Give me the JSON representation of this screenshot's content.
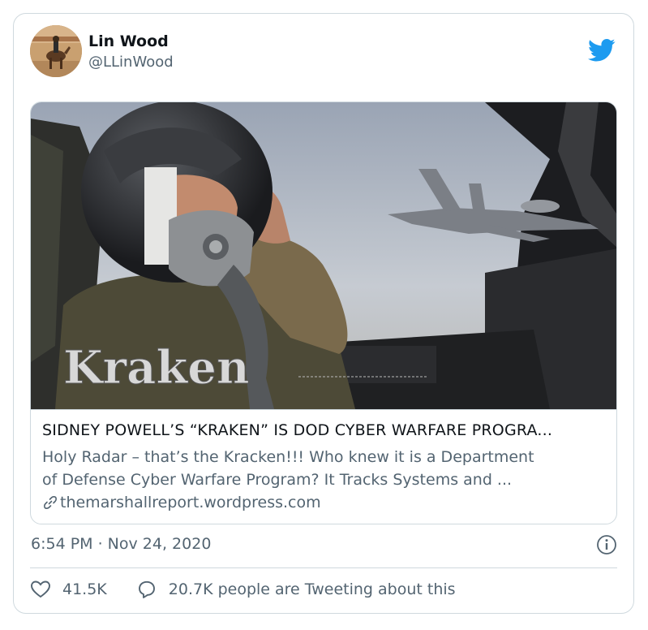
{
  "tweet": {
    "author": {
      "display_name": "Lin Wood",
      "handle": "@LLinWood",
      "avatar_icon": "avatar-horse-rider"
    },
    "brand_icon": "twitter-bird-icon",
    "brand_color": "#1d9bf0",
    "link_card": {
      "image_overlay_text": "Kraken",
      "title": "SIDNEY POWELL’S “KRAKEN” IS DOD CYBER WARFARE PROGRA...",
      "description_line1": "Holy Radar – that’s the Kracken!!! Who knew it is a Department",
      "description_line2": "of Defense Cyber Warfare Program? It Tracks Systems and ...",
      "domain": "themarshallreport.wordpress.com",
      "domain_icon": "link-icon"
    },
    "timestamp": "6:54 PM · Nov 24, 2020",
    "info_icon": "info-icon",
    "likes": "41.5K",
    "like_icon": "heart-icon",
    "reply_text": "20.7K people are Tweeting about this",
    "reply_icon": "speech-bubble-icon"
  }
}
